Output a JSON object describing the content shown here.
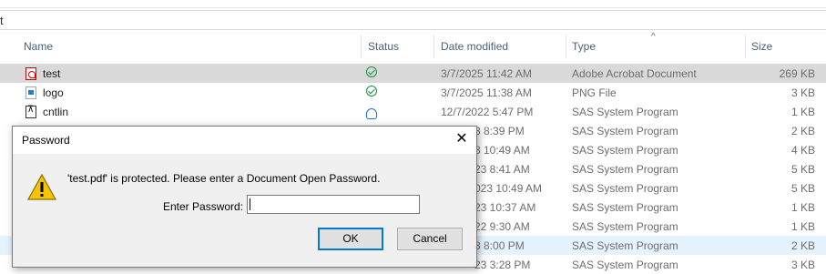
{
  "address": {
    "fragment": "t"
  },
  "columns": {
    "name": "Name",
    "status": "Status",
    "date": "Date modified",
    "type": "Type",
    "size": "Size",
    "sort_indicator": "^"
  },
  "rows": [
    {
      "name": "test",
      "icon": "pdf-file-icon",
      "status": "synced",
      "date": "3/7/2025 11:42 AM",
      "type": "Adobe Acrobat Document",
      "size": "269 KB",
      "selected": true
    },
    {
      "name": "logo",
      "icon": "png-file-icon",
      "status": "synced",
      "date": "3/7/2025 11:38 AM",
      "type": "PNG File",
      "size": "3 KB"
    },
    {
      "name": "cntlin",
      "icon": "sas-program-icon",
      "status": "cloud",
      "date": "12/7/2022 5:47 PM",
      "type": "SAS System Program",
      "size": "1 KB"
    },
    {
      "name": "",
      "date": "3 8:39 PM",
      "type": "SAS System Program",
      "size": "2 KB"
    },
    {
      "name": "",
      "date": "3 10:49 AM",
      "type": "SAS System Program",
      "size": "4 KB"
    },
    {
      "name": "",
      "date": "23 8:41 AM",
      "type": "SAS System Program",
      "size": "5 KB"
    },
    {
      "name": "",
      "date": "023 10:49 AM",
      "type": "SAS System Program",
      "size": "5 KB"
    },
    {
      "name": "",
      "date": "23 10:37 AM",
      "type": "SAS System Program",
      "size": "1 KB"
    },
    {
      "name": "",
      "date": "22 9:30 AM",
      "type": "SAS System Program",
      "size": "1 KB"
    },
    {
      "name": "",
      "date": "3 8:00 PM",
      "type": "SAS System Program",
      "size": "2 KB",
      "hover": true
    },
    {
      "name": "",
      "date": "23 3:28 PM",
      "type": "SAS System Program",
      "size": "3 KB"
    }
  ],
  "dialog": {
    "title": "Password",
    "close_glyph": "✕",
    "message": "'test.pdf' is protected. Please enter a Document Open Password.",
    "password_label": "Enter Password:",
    "password_value": "",
    "ok_label": "OK",
    "cancel_label": "Cancel",
    "icon": "warning-icon"
  }
}
